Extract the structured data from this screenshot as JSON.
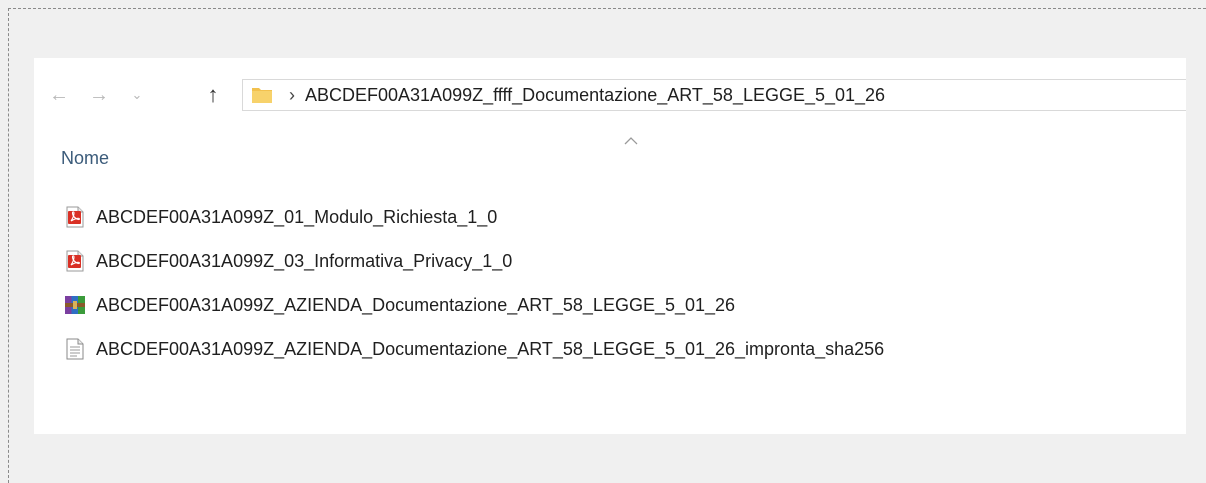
{
  "navigation": {
    "back_icon": "arrow-left-icon",
    "forward_icon": "arrow-right-icon",
    "recent_icon": "chevron-down-icon",
    "up_icon": "arrow-up-icon",
    "back_glyph": "←",
    "forward_glyph": "→",
    "recent_glyph": "⌄",
    "up_glyph": "↑"
  },
  "address_bar": {
    "folder_icon": "folder-icon",
    "separator": "›",
    "path_segment": "ABCDEF00A31A099Z_ffff_Documentazione_ART_58_LEGGE_5_01_26"
  },
  "list": {
    "sort_indicator": "ascending",
    "column_header": "Nome",
    "files": [
      {
        "name": "ABCDEF00A31A099Z_01_Modulo_Richiesta_1_0",
        "icon": "pdf-icon"
      },
      {
        "name": "ABCDEF00A31A099Z_03_Informativa_Privacy_1_0",
        "icon": "pdf-icon"
      },
      {
        "name": "ABCDEF00A31A099Z_AZIENDA_Documentazione_ART_58_LEGGE_5_01_26",
        "icon": "winrar-archive-icon"
      },
      {
        "name": "ABCDEF00A31A099Z_AZIENDA_Documentazione_ART_58_LEGGE_5_01_26_impronta_sha256",
        "icon": "text-file-icon"
      }
    ]
  },
  "colors": {
    "background": "#f0f0f0",
    "window": "#ffffff",
    "header_text": "#3b5b7a",
    "pdf_red": "#d93025",
    "folder_yellow": "#f2c14e"
  }
}
